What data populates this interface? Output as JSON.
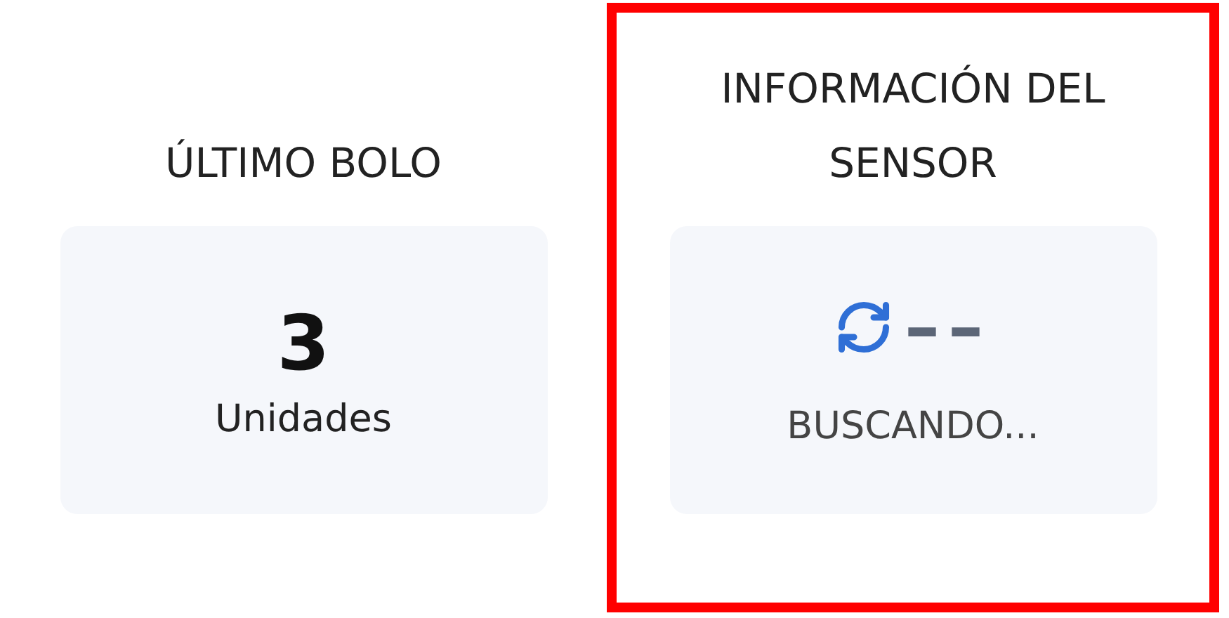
{
  "panels": [
    {
      "kind": "count",
      "title": "ÚLTIMO BOLO",
      "value": "3",
      "unit": "Unidades",
      "highlighted": false
    },
    {
      "kind": "sensor",
      "title": "INFORMACIÓN DEL SENSOR",
      "value": "––",
      "status": "BUSCANDO...",
      "highlighted": true
    }
  ]
}
